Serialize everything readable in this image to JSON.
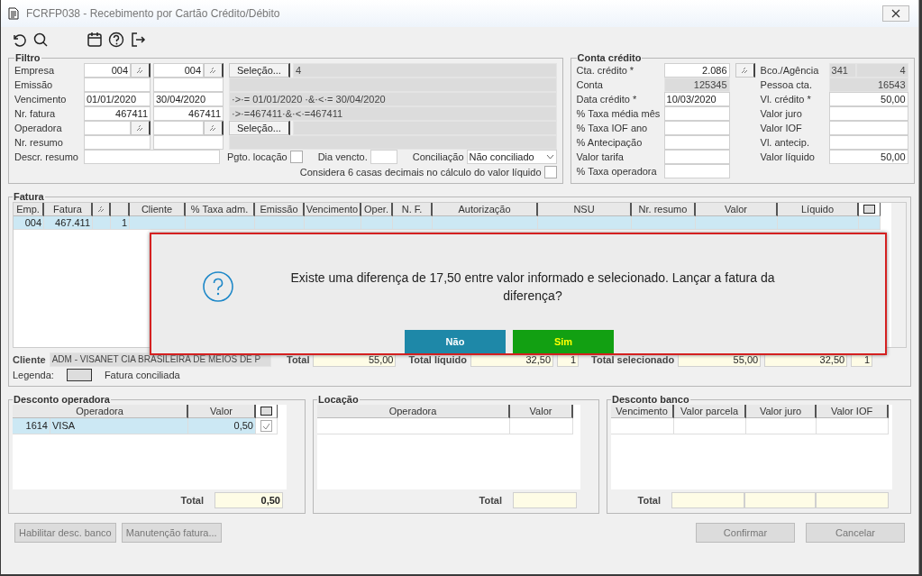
{
  "window": {
    "title": "FCRFP038 - Recebimento por Cartão Crédito/Débito"
  },
  "filtro": {
    "title": "Filtro",
    "rows": [
      {
        "label": "Empresa",
        "from": "004",
        "to": "004",
        "lookup": true,
        "button": "Seleção...",
        "summary": "4"
      },
      {
        "label": "Emissão",
        "lookup": false
      },
      {
        "label": "Vencimento",
        "from": "01/01/2020",
        "to": "30/04/2020",
        "lookup": false,
        "summary": "·>·= 01/01/2020 ·&·<·= 30/04/2020"
      },
      {
        "label": "Nr. fatura",
        "from": "467411",
        "to": "467411",
        "lookup": false,
        "summary": "·>·=467411·&·<·=467411"
      },
      {
        "label": "Operadora",
        "lookup": true,
        "button": "Seleção..."
      },
      {
        "label": "Nr. resumo",
        "lookup": false
      }
    ],
    "descr_resumo": {
      "label": "Descr. resumo"
    },
    "pgto_locacao": {
      "label": "Pgto. locação",
      "checked": false
    },
    "dia_vencto": {
      "label": "Dia vencto."
    },
    "conciliacao": {
      "label": "Conciliação",
      "value": "Não conciliado"
    },
    "decimais": {
      "label": "Considera 6 casas decimais no cálculo do valor líquido",
      "checked": false
    }
  },
  "conta_credito": {
    "title": "Conta crédito",
    "left": [
      {
        "label": "Cta. crédito *",
        "value": "2.086",
        "readonly": false,
        "lookup": true
      },
      {
        "label": "Conta",
        "value": "125345",
        "readonly": true
      },
      {
        "label": "Data crédito *",
        "value": "10/03/2020",
        "readonly": false
      },
      {
        "label": "% Taxa média mês",
        "readonly": false
      },
      {
        "label": "% Taxa IOF ano",
        "readonly": false
      },
      {
        "label": "% Antecipação",
        "readonly": false
      },
      {
        "label": "Valor tarifa",
        "readonly": false
      },
      {
        "label": "% Taxa operadora",
        "readonly": false
      }
    ],
    "right": [
      {
        "label": "Bco./Agência",
        "values": [
          "341",
          "4"
        ],
        "readonly": true
      },
      {
        "label": "Pessoa cta.",
        "values": [
          "16543"
        ],
        "readonly": true
      },
      {
        "label": "Vl. crédito *",
        "values": [
          "50,00"
        ],
        "readonly": false
      },
      {
        "label": "Valor juro",
        "readonly": false
      },
      {
        "label": "Valor IOF",
        "readonly": false
      },
      {
        "label": "Vl. antecip.",
        "readonly": false
      },
      {
        "label": "Valor líquido",
        "values": [
          "50,00"
        ],
        "readonly": false
      }
    ]
  },
  "fatura": {
    "title": "Fatura",
    "columns": [
      {
        "kind": "text",
        "label": "Emp."
      },
      {
        "kind": "text",
        "label": "Fatura"
      },
      {
        "kind": "lookup"
      },
      {
        "kind": "blank"
      },
      {
        "kind": "text",
        "label": "Cliente"
      },
      {
        "kind": "text",
        "label": "% Taxa adm."
      },
      {
        "kind": "text",
        "label": "Emissão"
      },
      {
        "kind": "text",
        "label": "Vencimento"
      },
      {
        "kind": "text",
        "label": "Oper."
      },
      {
        "kind": "text",
        "label": "N. F."
      },
      {
        "kind": "text",
        "label": "Autorização"
      },
      {
        "kind": "text",
        "label": "NSU"
      },
      {
        "kind": "text",
        "label": "Nr. resumo"
      },
      {
        "kind": "text",
        "label": "Valor"
      },
      {
        "kind": "text",
        "label": "Líquido"
      },
      {
        "kind": "toggle"
      }
    ],
    "rows": [
      {
        "cells": [
          "004",
          "467.411",
          "1"
        ],
        "selected": true
      }
    ],
    "totals": [
      {
        "label": "Total",
        "values": [
          "55,00"
        ]
      },
      {
        "label": "Total líquido",
        "values": [
          "32,50",
          "1"
        ]
      },
      {
        "label": "Total selecionado",
        "values": [
          "55,00",
          "32,50",
          "1"
        ]
      }
    ],
    "cliente": {
      "label": "Cliente",
      "value": "ADM - VISANET CIA BRASILEIRA DE MEIOS DE P"
    },
    "legenda": {
      "label": "Legenda:",
      "text": "Fatura conciliada"
    }
  },
  "desconto_operadora": {
    "title": "Desconto operadora",
    "columns": [
      "Operadora",
      "Valor"
    ],
    "toggle": true,
    "rows": [
      {
        "code": "1614",
        "name": "VISA",
        "valor": "0,50",
        "checked": true,
        "selected": true
      }
    ],
    "total_label": "Total",
    "totals": [
      "0,50"
    ]
  },
  "locacao": {
    "title": "Locação",
    "columns": [
      "Operadora",
      "Valor"
    ],
    "toggle": false,
    "total_label": "Total"
  },
  "desconto_banco": {
    "title": "Desconto banco",
    "columns": [
      "Vencimento",
      "Valor parcela",
      "Valor juro",
      "Valor IOF"
    ],
    "toggle": false,
    "total_label": "Total"
  },
  "footer": {
    "left": [
      {
        "label": "Habilitar desc. banco",
        "disabled": true
      },
      {
        "label": "Manutenção fatura...",
        "disabled": true
      }
    ],
    "right": [
      {
        "label": "Confirmar",
        "disabled": true
      },
      {
        "label": "Cancelar",
        "disabled": true
      }
    ]
  },
  "dialog": {
    "message": "Existe uma diferença de 17,50 entre valor informado e selecionado. Lançar a fatura da diferença?",
    "buttons": [
      {
        "label": "Não",
        "kind": "no"
      },
      {
        "label": "Sim",
        "kind": "yes"
      }
    ]
  }
}
